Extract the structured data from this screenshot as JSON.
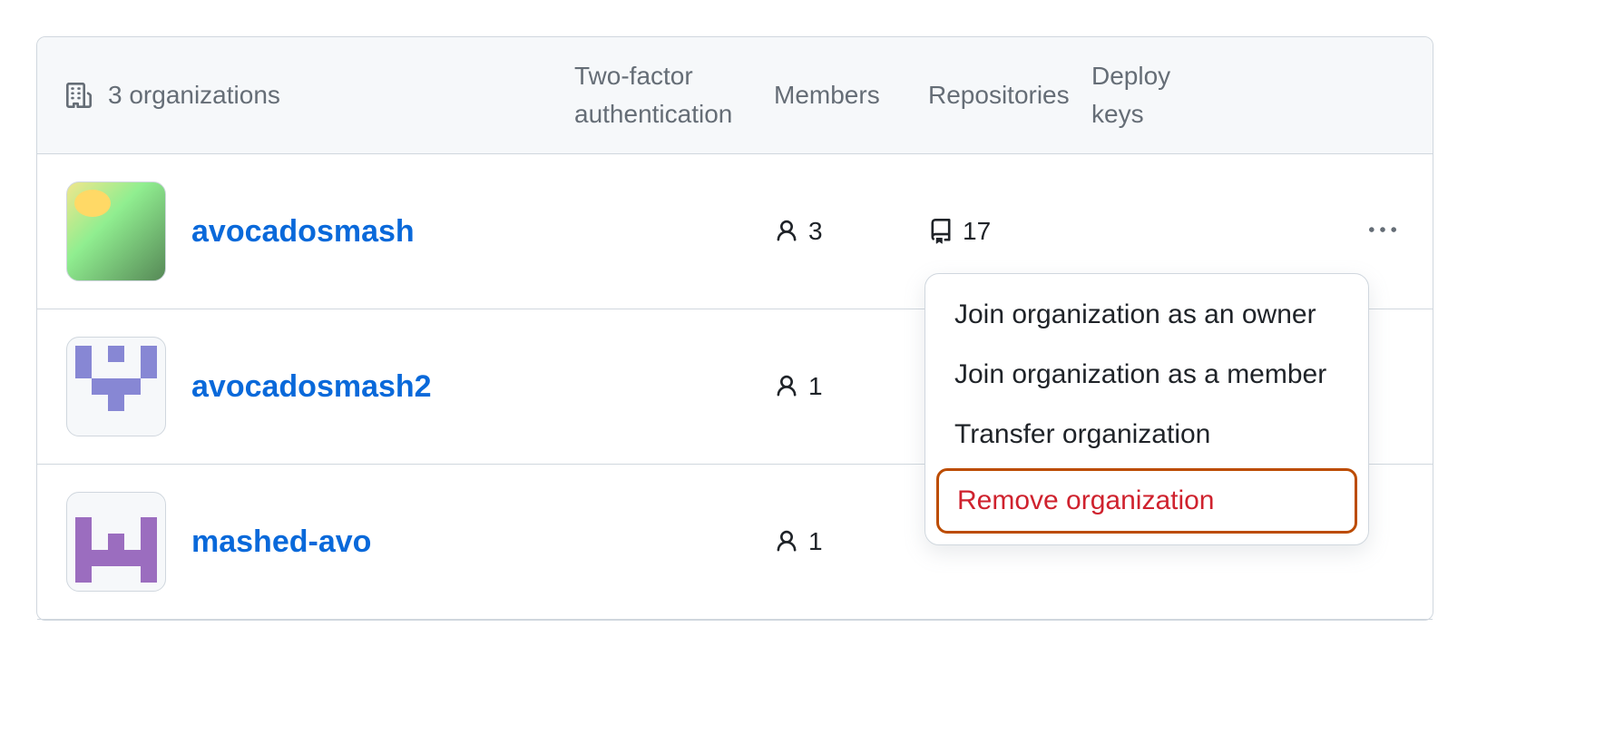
{
  "header": {
    "title": "3 organizations",
    "columns": {
      "two_factor": "Two-factor authentication",
      "members": "Members",
      "repositories": "Repositories",
      "deploy_keys": "Deploy keys"
    }
  },
  "organizations": [
    {
      "name": "avocadosmash",
      "members": "3",
      "repositories": "17"
    },
    {
      "name": "avocadosmash2",
      "members": "1",
      "repositories": ""
    },
    {
      "name": "mashed-avo",
      "members": "1",
      "repositories": ""
    }
  ],
  "dropdown": {
    "join_owner": "Join organization as an owner",
    "join_member": "Join organization as a member",
    "transfer": "Transfer organization",
    "remove": "Remove organization"
  }
}
